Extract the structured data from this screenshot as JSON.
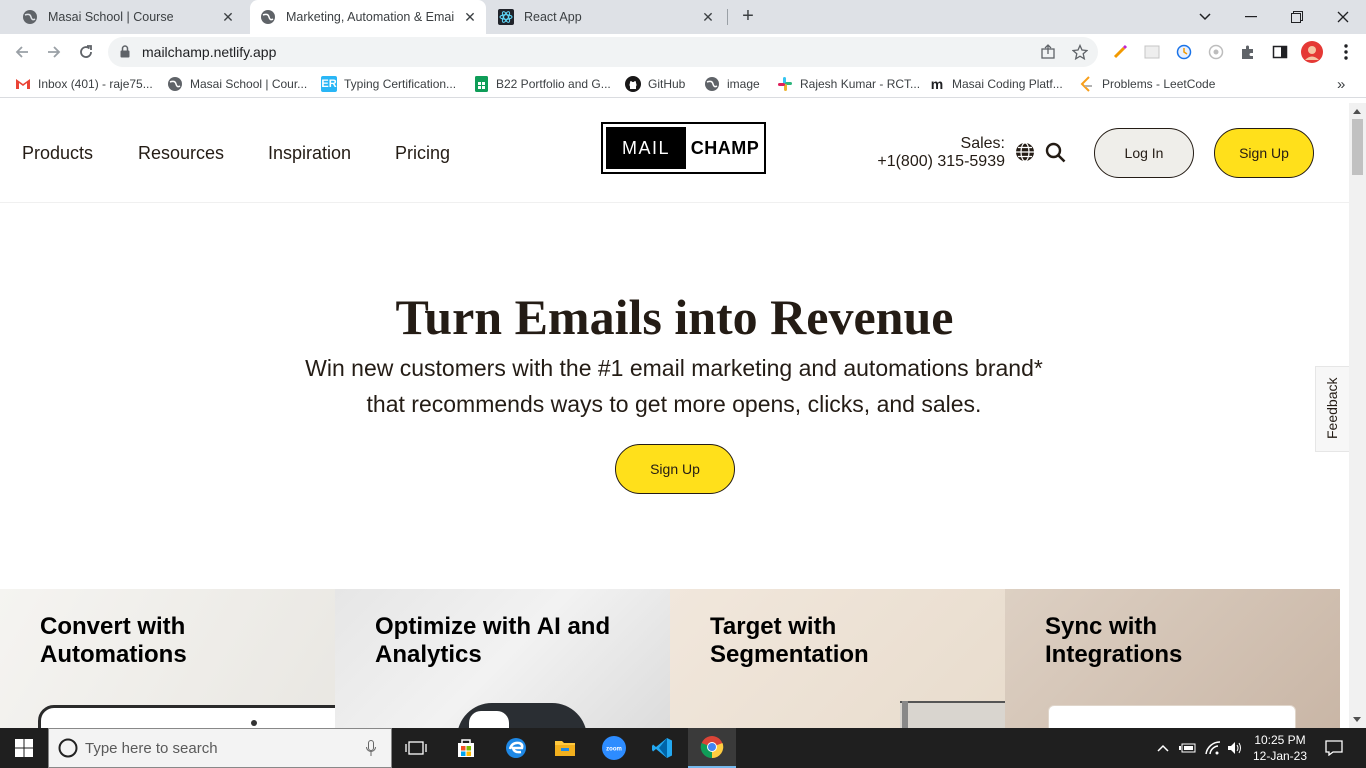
{
  "browser": {
    "tabs": [
      {
        "title": "Masai School | Course",
        "active": false
      },
      {
        "title": "Marketing, Automation & Email Ma",
        "active": true
      },
      {
        "title": "React App",
        "active": false
      }
    ],
    "new_tab_symbol": "+",
    "url": "mailchamp.netlify.app",
    "bookmarks": [
      {
        "label": "Inbox (401) - raje75...",
        "icon": "gmail-icon"
      },
      {
        "label": "Masai School | Cour...",
        "icon": "globe-icon"
      },
      {
        "label": "Typing Certification...",
        "icon": "typing-icon"
      },
      {
        "label": "B22 Portfolio and G...",
        "icon": "sheets-icon"
      },
      {
        "label": "GitHub",
        "icon": "github-icon"
      },
      {
        "label": "image",
        "icon": "globe-icon"
      },
      {
        "label": "Rajesh Kumar - RCT...",
        "icon": "slack-icon"
      },
      {
        "label": "Masai Coding Platf...",
        "icon": "masai-icon"
      },
      {
        "label": "Problems - LeetCode",
        "icon": "leetcode-icon"
      }
    ],
    "bookmarks_more": "»"
  },
  "site": {
    "nav": [
      "Products",
      "Resources",
      "Inspiration",
      "Pricing"
    ],
    "logo": {
      "left": "MAIL",
      "right": "CHAMP"
    },
    "sales_label": "Sales:",
    "sales_phone": "+1(800) 315-5939",
    "login_label": "Log In",
    "signup_label": "Sign Up",
    "hero": {
      "title": "Turn Emails into Revenue",
      "subtitle_line1": "Win new customers with the #1 email marketing and automations brand*",
      "subtitle_line2": "that recommends ways to get more opens, clicks, and sales.",
      "cta": "Sign Up"
    },
    "feedback": "Feedback",
    "cards": [
      {
        "line1": "Convert with",
        "line2": "Automations"
      },
      {
        "line1": "Optimize with AI and",
        "line2": "Analytics"
      },
      {
        "line1": "Target with",
        "line2": "Segmentation"
      },
      {
        "line1": "Sync with",
        "line2": "Integrations"
      }
    ],
    "colors": {
      "brand_yellow": "#ffe01b",
      "text_dark": "#241c15"
    }
  },
  "taskbar": {
    "search_placeholder": "Type here to search",
    "time": "10:25 PM",
    "date": "12-Jan-23"
  }
}
